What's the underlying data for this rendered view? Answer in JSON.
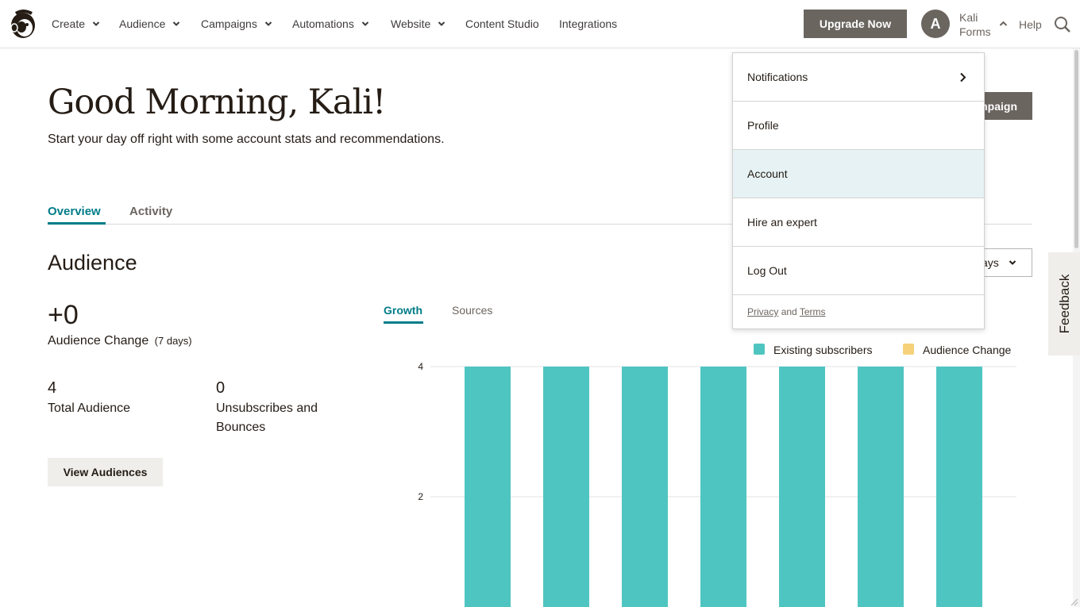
{
  "nav": {
    "items": [
      {
        "label": "Create",
        "has_menu": true
      },
      {
        "label": "Audience",
        "has_menu": true
      },
      {
        "label": "Campaigns",
        "has_menu": true
      },
      {
        "label": "Automations",
        "has_menu": true
      },
      {
        "label": "Website",
        "has_menu": true
      },
      {
        "label": "Content Studio",
        "has_menu": false
      },
      {
        "label": "Integrations",
        "has_menu": false
      }
    ],
    "upgrade_label": "Upgrade Now",
    "avatar_initial": "A",
    "user_first": "Kali",
    "user_last": "Forms",
    "help_label": "Help"
  },
  "header": {
    "greeting": "Good Morning, Kali!",
    "subtitle": "Start your day off right with some account stats and recommendations.",
    "campaign_button_label": "npaign"
  },
  "tabs": [
    {
      "label": "Overview",
      "active": true
    },
    {
      "label": "Activity",
      "active": false
    }
  ],
  "audience": {
    "title": "Audience",
    "range_label": "ays",
    "change_value": "+0",
    "change_label": "Audience Change",
    "change_period": "(7 days)",
    "total_value": "4",
    "total_label": "Total Audience",
    "unsub_value": "0",
    "unsub_label_line1": "Unsubscribes and",
    "unsub_label_line2": "Bounces",
    "view_button_label": "View Audiences"
  },
  "chart_tabs": [
    {
      "label": "Growth",
      "active": true
    },
    {
      "label": "Sources",
      "active": false
    }
  ],
  "chart_data": {
    "type": "bar",
    "categories": [
      "",
      "",
      "",
      "",
      "",
      "",
      ""
    ],
    "series": [
      {
        "name": "Existing subscribers",
        "color": "#4fc5c1",
        "values": [
          4,
          4,
          4,
          4,
          4,
          4,
          4
        ]
      },
      {
        "name": "Audience Change",
        "color": "#f5d27a",
        "values": [
          0,
          0,
          0,
          0,
          0,
          0,
          0
        ]
      }
    ],
    "y_ticks": [
      "4",
      "2"
    ],
    "ylim": [
      0,
      4
    ],
    "grid": true,
    "legend": "top-right"
  },
  "feedback_label": "Feedback",
  "menu": {
    "items": [
      {
        "label": "Notifications",
        "has_arrow": true,
        "highlighted": false
      },
      {
        "label": "Profile",
        "has_arrow": false,
        "highlighted": false
      },
      {
        "label": "Account",
        "has_arrow": false,
        "highlighted": true
      },
      {
        "label": "Hire an expert",
        "has_arrow": false,
        "highlighted": false
      },
      {
        "label": "Log Out",
        "has_arrow": false,
        "highlighted": false
      }
    ],
    "footer_privacy": "Privacy",
    "footer_and": "and",
    "footer_terms": "Terms"
  },
  "colors": {
    "accent": "#007c89",
    "button_dark": "#6b6560",
    "bar_teal": "#4fc5c1",
    "bar_yellow": "#f5d27a",
    "menu_highlight": "#e6f2f3"
  }
}
